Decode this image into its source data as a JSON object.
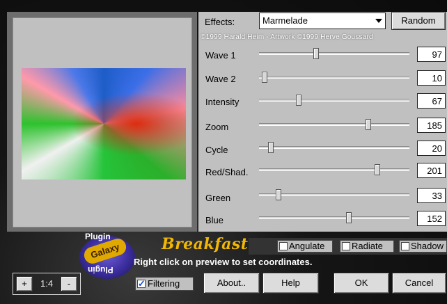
{
  "effects": {
    "label": "Effects:",
    "selected": "Marmelade"
  },
  "random_label": "Random",
  "copyright": "©1999 Harald Heim - Artwork ©1999 Herve Goussard",
  "sliders": [
    {
      "label": "Wave 1",
      "value": 97,
      "max": 255
    },
    {
      "label": "Wave 2",
      "value": 10,
      "max": 255
    },
    {
      "label": "Intensity",
      "value": 67,
      "max": 255
    },
    {
      "label": "Zoom",
      "value": 185,
      "max": 255
    },
    {
      "label": "Cycle",
      "value": 20,
      "max": 255
    },
    {
      "label": "Red/Shad.",
      "value": 201,
      "max": 255
    },
    {
      "label": "Green",
      "value": 33,
      "max": 255
    },
    {
      "label": "Blue",
      "value": 152,
      "max": 255
    }
  ],
  "logo": {
    "top": "Plugin",
    "middle": "Galaxy",
    "bottom": "Plugin"
  },
  "filter_name": "Breakfast",
  "hint": "Right click on preview to set coordinates.",
  "options": [
    {
      "label": "Angulate",
      "checked": false
    },
    {
      "label": "Radiate",
      "checked": false
    },
    {
      "label": "Shadow",
      "checked": false
    }
  ],
  "zoom": {
    "plus": "+",
    "level": "1:4",
    "minus": "-"
  },
  "filtering": {
    "label": "Filtering",
    "checked": true
  },
  "buttons": {
    "about": "About..",
    "help": "Help",
    "ok": "OK",
    "cancel": "Cancel"
  }
}
